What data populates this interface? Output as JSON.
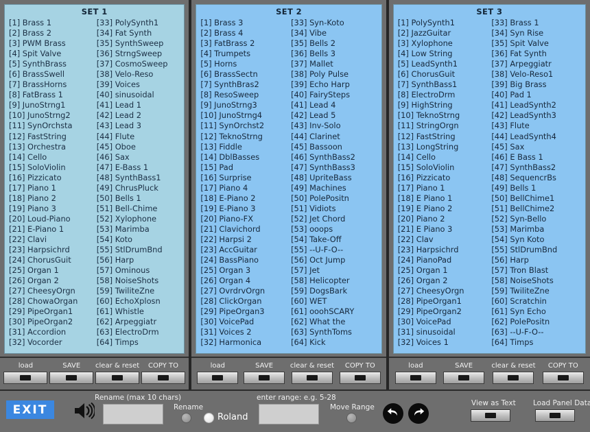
{
  "sets": [
    {
      "title": "SET 1",
      "entries": [
        "[1] Brass 1",
        "[2] Brass 2",
        "[3] PWM Brass",
        "[4] Spit Valve",
        "[5] SynthBrass",
        "[6] BrassSwell",
        "[7] BrassHorns",
        "[8] FatBrass 1",
        "[9] JunoStrng1",
        "[10] JunoStrng2",
        "[11] SynOrchsta",
        "[12] FastString",
        "[13] Orchestra",
        "[14] Cello",
        "[15] SoloViolin",
        "[16] Pizzicato",
        "[17] Piano 1",
        "[18] Piano 2",
        "[19] Piano 3",
        "[20] Loud-Piano",
        "[21] E-Piano 1",
        "[22] Clavi",
        "[23] Harpsichrd",
        "[24] ChorusGuit",
        "[25] Organ 1",
        "[26] Organ 2",
        "[27] CheesyOrgn",
        "[28] ChowaOrgan",
        "[29] PipeOrgan1",
        "[30] PipeOrgan2",
        "[31] Accordion",
        "[32] Vocorder",
        "[33] PolySynth1",
        "[34] Fat Synth",
        "[35] SynthSweep",
        "[36] StrngSweep",
        "[37] CosmoSweep",
        "[38] Velo-Reso",
        "[39] Voices",
        "[40] sinusoidal",
        "[41] Lead 1",
        "[42] Lead 2",
        "[43] Lead 3",
        "[44] Flute",
        "[45] Oboe",
        "[46] Sax",
        "[47] E-Bass 1",
        "[48] SynthBass1",
        "[49] ChrusPluck",
        "[50] Bells 1",
        "[51] Bell-Chime",
        "[52] Xylophone",
        "[53] Marimba",
        "[54] Koto",
        "[55] StlDrumBnd",
        "[56] Harp",
        "[57] Ominous",
        "[58] NoiseShots",
        "[59] TwiliteZne",
        "[60] EchoXplosn",
        "[61] Whistle",
        "[62] Arpeggiatr",
        "[63] ElectroDrm",
        "[64] Timps"
      ],
      "buttons": [
        {
          "label": "load"
        },
        {
          "label": "SAVE"
        },
        {
          "label": "clear & reset"
        },
        {
          "label": "COPY TO"
        }
      ]
    },
    {
      "title": "SET 2",
      "entries": [
        "[1] Brass 3",
        "[2] Brass 4",
        "[3] FatBrass 2",
        "[4] Trumpets",
        "[5] Horns",
        "[6] BrassSectn",
        "[7] SynthBras2",
        "[8] ResoSweep",
        "[9] JunoStrng3",
        "[10] JunoStrng4",
        "[11] SynOrchst2",
        "[12] TeknoStrng",
        "[13] Fiddle",
        "[14] DblBasses",
        "[15] Pad",
        "[16] Surprise",
        "[17] Piano 4",
        "[18] E-Piano 2",
        "[19] E-Piano 3",
        "[20] Piano-FX",
        "[21] Clavichord",
        "[22] Harpsi 2",
        "[23] AccGuitar",
        "[24] BassPiano",
        "[25] Organ 3",
        "[26] Organ 4",
        "[27] OvrdrvOrgn",
        "[28] ClickOrgan",
        "[29] PipeOrgan3",
        "[30] VoicePad",
        "[31] Voices 2",
        "[32] Harmonica",
        "[33] Syn-Koto",
        "[34] Vibe",
        "[35] Bells 2",
        "[36] Bells 3",
        "[37] Mallet",
        "[38] Poly Pulse",
        "[39] Echo Harp",
        "[40] FairySteps",
        "[41] Lead 4",
        "[42] Lead 5",
        "[43] Inv-Solo",
        "[44] Clarinet",
        "[45] Bassoon",
        "[46] SynthBass2",
        "[47] SynthBass3",
        "[48] UpriteBass",
        "[49] Machines",
        "[50] PolePositn",
        "[51] Vidiots",
        "[52] Jet Chord",
        "[53] ooops",
        "[54] Take-Off",
        "[55] --U-F-O--",
        "[56] Oct Jump",
        "[57] Jet",
        "[58] Helicopter",
        "[59] DogsBark",
        "[60] WET",
        "[61] ooohSCARY",
        "[62] What the",
        "[63] SynthToms",
        "[64] Kick"
      ],
      "buttons": [
        {
          "label": "load"
        },
        {
          "label": "SAVE"
        },
        {
          "label": "clear & reset"
        },
        {
          "label": "COPY TO"
        }
      ]
    },
    {
      "title": "SET 3",
      "entries": [
        "[1] PolySynth1",
        "[2] JazzGuitar",
        "[3] Xylophone",
        "[4] Low String",
        "[5] LeadSynth1",
        "[6] ChorusGuit",
        "[7] SynthBass1",
        "[8] ElectroDrm",
        "[9] HighString",
        "[10] TeknoStrng",
        "[11] StringOrgn",
        "[12] FastString",
        "[13] LongString",
        "[14] Cello",
        "[15] SoloViolin",
        "[16] Pizzicato",
        "[17] Piano 1",
        "[18] E Piano 1",
        "[19] E Piano 2",
        "[20] Piano 2",
        "[21] E Piano 3",
        "[22] Clav",
        "[23] Harpsichrd",
        "[24] PianoPad",
        "[25] Organ 1",
        "[26] Organ 2",
        "[27] CheesyOrgn",
        "[28] PipeOrgan1",
        "[29] PipeOrgan2",
        "[30] VoicePad",
        "[31] sinusoidal",
        "[32] Voices 1",
        "[33] Brass 1",
        "[34] Syn Rise",
        "[35] Spit Valve",
        "[36] Fat Synth",
        "[37] Arpeggiatr",
        "[38] Velo-Reso1",
        "[39] Big Brass",
        "[40] Pad 1",
        "[41] LeadSynth2",
        "[42] LeadSynth3",
        "[43] Flute",
        "[44] LeadSynth4",
        "[45] Sax",
        "[46] E Bass 1",
        "[47] SynthBass2",
        "[48] SequencrBs",
        "[49] Bells 1",
        "[50] BellChime1",
        "[51] BellChime2",
        "[52] Syn-Bello",
        "[53] Marimba",
        "[54] Syn Koto",
        "[55] StlDrumBnd",
        "[56] Harp",
        "[57] Tron Blast",
        "[58] NoiseShots",
        "[59] TwiliteZne",
        "[60] Scratchin",
        "[61] Syn Echo",
        "[62] PolePositn",
        "[63] --U-F-O--",
        "[64] Timps"
      ],
      "buttons": [
        {
          "label": "load"
        },
        {
          "label": "SAVE"
        },
        {
          "label": "clear & reset"
        },
        {
          "label": "COPY TO"
        }
      ]
    }
  ],
  "toolbar": {
    "exit_label": "EXIT",
    "rename_label": "Rename (max 10 chars)",
    "rename_value": "",
    "rename_knob_label": "Rename",
    "roland_label": "Roland",
    "range_label": "enter range: e.g. 5-28",
    "range_value": "",
    "move_range_label": "Move Range",
    "view_as_text_label": "View as Text",
    "load_panel_data_label": "Load Panel Data",
    "undo_icon": "undo-icon",
    "redo_icon": "redo-icon",
    "speaker_icon": "speaker-icon"
  },
  "colors": {
    "set1_bg": "#a6d3e3",
    "set2_bg": "#8bc5f2",
    "set3_bg": "#8bc5f2",
    "chrome": "#6e6e6e",
    "accent": "#3b87e0",
    "text": "#1b2f44"
  }
}
